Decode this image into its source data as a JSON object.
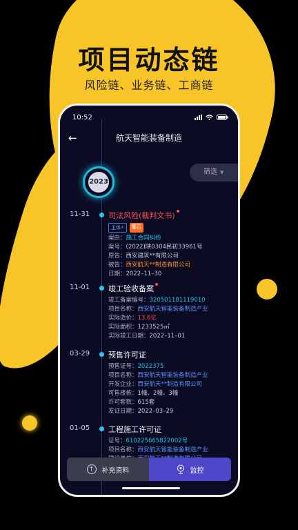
{
  "promo": {
    "headline": "项目动态链",
    "subline": "风险链、业务链、工商链"
  },
  "colors": {
    "accent_yellow": "#f7c527",
    "phone_bg": "#0b0c24",
    "timeline_cyan": "#29c8ec",
    "risk_red": "#ff4f4f",
    "monitor_purple": "#4e46c8"
  },
  "status_bar": {
    "time": "10:52",
    "icons": [
      "signal-icon",
      "wifi-icon",
      "battery-icon"
    ]
  },
  "nav": {
    "back_icon": "←",
    "title": "航天智能装备制造"
  },
  "timeline": {
    "year": "2023",
    "filter_label": "筛选",
    "filter_icon": "▼"
  },
  "entries": [
    {
      "date": "11-31",
      "title": "司法风险(裁判文书)",
      "tags": [
        "主体⚡",
        "警示"
      ],
      "rows": [
        {
          "k": "案由：",
          "v": "施工合同纠纷"
        },
        {
          "k": "案号：",
          "v": "(2022)陕0304民初33961号"
        },
        {
          "k": "原告：",
          "v": "西安建筑**有限公司"
        },
        {
          "k": "被告：",
          "v": "西安航天**制造有限公司"
        },
        {
          "k": "日期：",
          "v": "2022–11–30"
        }
      ]
    },
    {
      "date": "11-01",
      "title": "竣工验收备案",
      "rows": [
        {
          "k": "竣工备案编号：",
          "v": "320501181119010"
        },
        {
          "k": "项目名称：",
          "v": "西安航天智能装备制造产业"
        },
        {
          "k": "实际造价：",
          "v": "13.6亿"
        },
        {
          "k": "实际面积：",
          "v": "1233525㎡"
        },
        {
          "k": "实际竣工日期：",
          "v": "2022–11–01"
        }
      ]
    },
    {
      "date": "03-29",
      "title": "预售许可证",
      "rows": [
        {
          "k": "预售证号：",
          "v": "2022375"
        },
        {
          "k": "项目名称：",
          "v": "西安航天智能装备制造产业"
        },
        {
          "k": "开发企业：",
          "v": "西安航天**制造有限公司"
        },
        {
          "k": "可售楼栋：",
          "v": "1幢、2幢、3幢"
        },
        {
          "k": "许可套数：",
          "v": "615套"
        },
        {
          "k": "发证日期：",
          "v": "2022–03–29"
        }
      ]
    },
    {
      "date": "01-05",
      "title": "工程施工许可证",
      "rows": [
        {
          "k": "证号：",
          "v": "610225665822002号"
        },
        {
          "k": "项目名称：",
          "v": "西安航天智能装备制造产业"
        },
        {
          "k": "建设单位：",
          "v": "西安航天**制造有限公司"
        }
      ]
    }
  ],
  "bottom": {
    "supplement_label": "补充资料",
    "monitor_label": "监控"
  }
}
